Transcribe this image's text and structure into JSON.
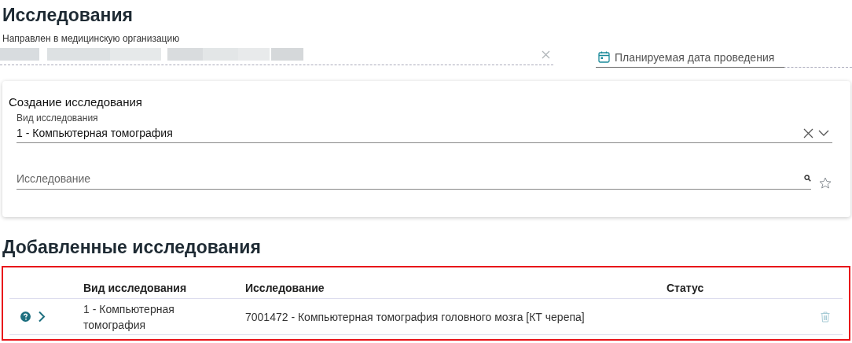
{
  "page_title": "Исследования",
  "referral": {
    "label": "Направлен в медицинскую организацию"
  },
  "planned_date": {
    "placeholder": "Планируемая дата проведения"
  },
  "create_card": {
    "title": "Создание исследования",
    "type_field": {
      "label": "Вид исследования",
      "value": "1 - Компьютерная томография"
    },
    "study_field": {
      "placeholder": "Исследование"
    }
  },
  "added_title": "Добавленные исследования",
  "table": {
    "columns": [
      "Вид исследования",
      "Исследование",
      "Статус"
    ],
    "rows": [
      {
        "type": "1 - Компьютерная томография",
        "study": "7001472 - Компьютерная томография головного мозга [КТ черепа]",
        "expanded": false
      }
    ]
  }
}
